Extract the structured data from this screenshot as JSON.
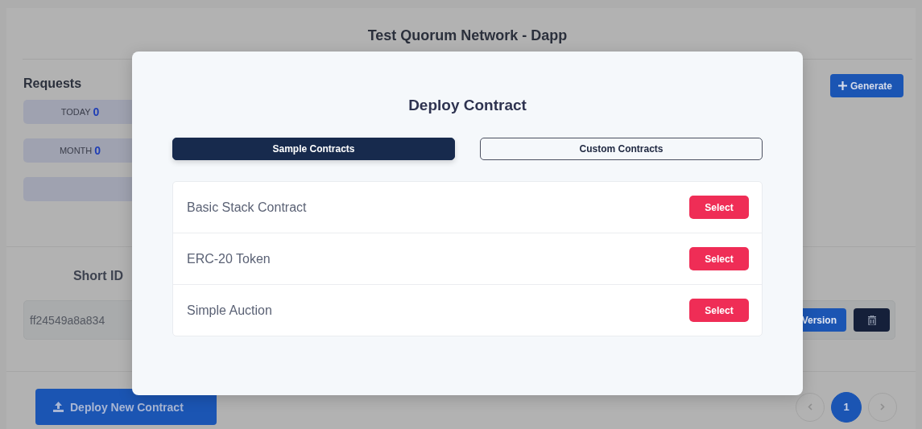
{
  "header": {
    "title": "Test Quorum Network - Dapp"
  },
  "requests": {
    "title": "Requests",
    "stats": [
      {
        "label": "TODAY",
        "value": "0"
      },
      {
        "label": "MONTH",
        "value": "0"
      }
    ]
  },
  "generate_button": {
    "label": "Generate"
  },
  "table": {
    "columns": [
      "Short ID"
    ],
    "rows": [
      {
        "short_id": "ff24549a8a834",
        "version_button": "Version"
      }
    ]
  },
  "deploy_button": {
    "label": "Deploy New Contract"
  },
  "pagination": {
    "pages": [
      {
        "label": "1",
        "selected": true
      }
    ]
  },
  "modal": {
    "title": "Deploy Contract",
    "tabs": [
      {
        "label": "Sample Contracts",
        "selected": true
      },
      {
        "label": "Custom Contracts",
        "selected": false
      }
    ],
    "contracts": [
      {
        "name": "Basic Stack Contract",
        "action": "Select"
      },
      {
        "name": "ERC-20 Token",
        "action": "Select"
      },
      {
        "name": "Simple Auction",
        "action": "Select"
      }
    ]
  }
}
